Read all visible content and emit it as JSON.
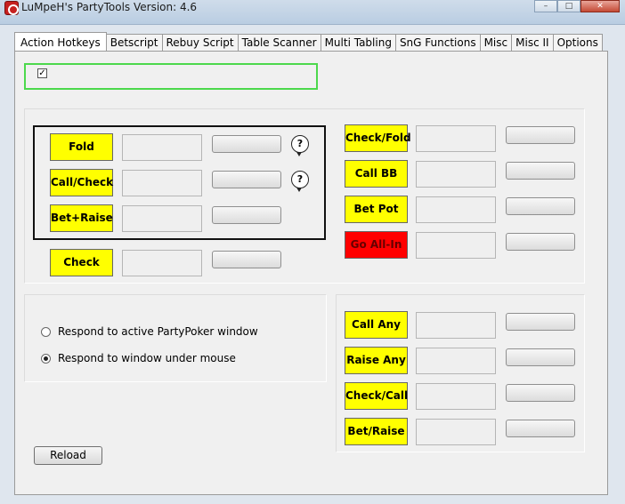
{
  "window": {
    "title": "LuMpeH's PartyTools   Version: 4.6",
    "min": "–",
    "max": "□",
    "close": "✕"
  },
  "tabs": [
    {
      "label": "Action Hotkeys"
    },
    {
      "label": "Betscript"
    },
    {
      "label": "Rebuy Script"
    },
    {
      "label": "Table Scanner"
    },
    {
      "label": "Multi Tabling"
    },
    {
      "label": "SnG Functions"
    },
    {
      "label": "Misc"
    },
    {
      "label": "Misc II"
    },
    {
      "label": "Options"
    }
  ],
  "enable_checkbox": {
    "mark": "✓"
  },
  "left_hotkeys": [
    {
      "label": "Fold"
    },
    {
      "label": "Call/Check"
    },
    {
      "label": "Bet+Raise"
    },
    {
      "label": "Check"
    }
  ],
  "help": {
    "symbol": "?"
  },
  "right_hotkeys_top": [
    {
      "label": "Check/Fold"
    },
    {
      "label": "Call BB"
    },
    {
      "label": "Bet Pot"
    },
    {
      "label": "Go All-In"
    }
  ],
  "right_hotkeys_bottom": [
    {
      "label": "Call Any"
    },
    {
      "label": "Raise Any"
    },
    {
      "label": "Check/Call"
    },
    {
      "label": "Bet/Raise"
    }
  ],
  "respond": {
    "option_active": "Respond to active PartyPoker window",
    "option_mouse": "Respond to window under mouse"
  },
  "reload_label": "Reload",
  "colors": {
    "hotkey_yellow": "#ffff00",
    "allin_red": "#ff0000",
    "highlight_green": "#4cd84c"
  }
}
